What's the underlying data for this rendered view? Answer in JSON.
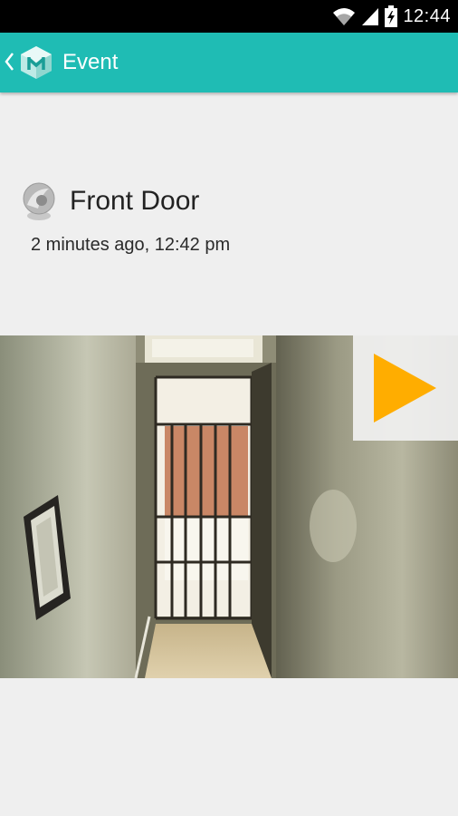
{
  "status_bar": {
    "time": "12:44",
    "icons": [
      "wifi-icon",
      "cell-signal-icon",
      "battery-icon"
    ]
  },
  "app_bar": {
    "title": "Event",
    "background_color": "#1fbcb4",
    "icons": [
      "back-chevron-icon",
      "app-logo-icon"
    ]
  },
  "event": {
    "device_name": "Front Door",
    "time": "2 minutes ago, 12:42 pm",
    "device_icon": "camera-icon"
  },
  "snapshot": {
    "play_icon": "play-icon",
    "play_color": "#ffad00"
  }
}
